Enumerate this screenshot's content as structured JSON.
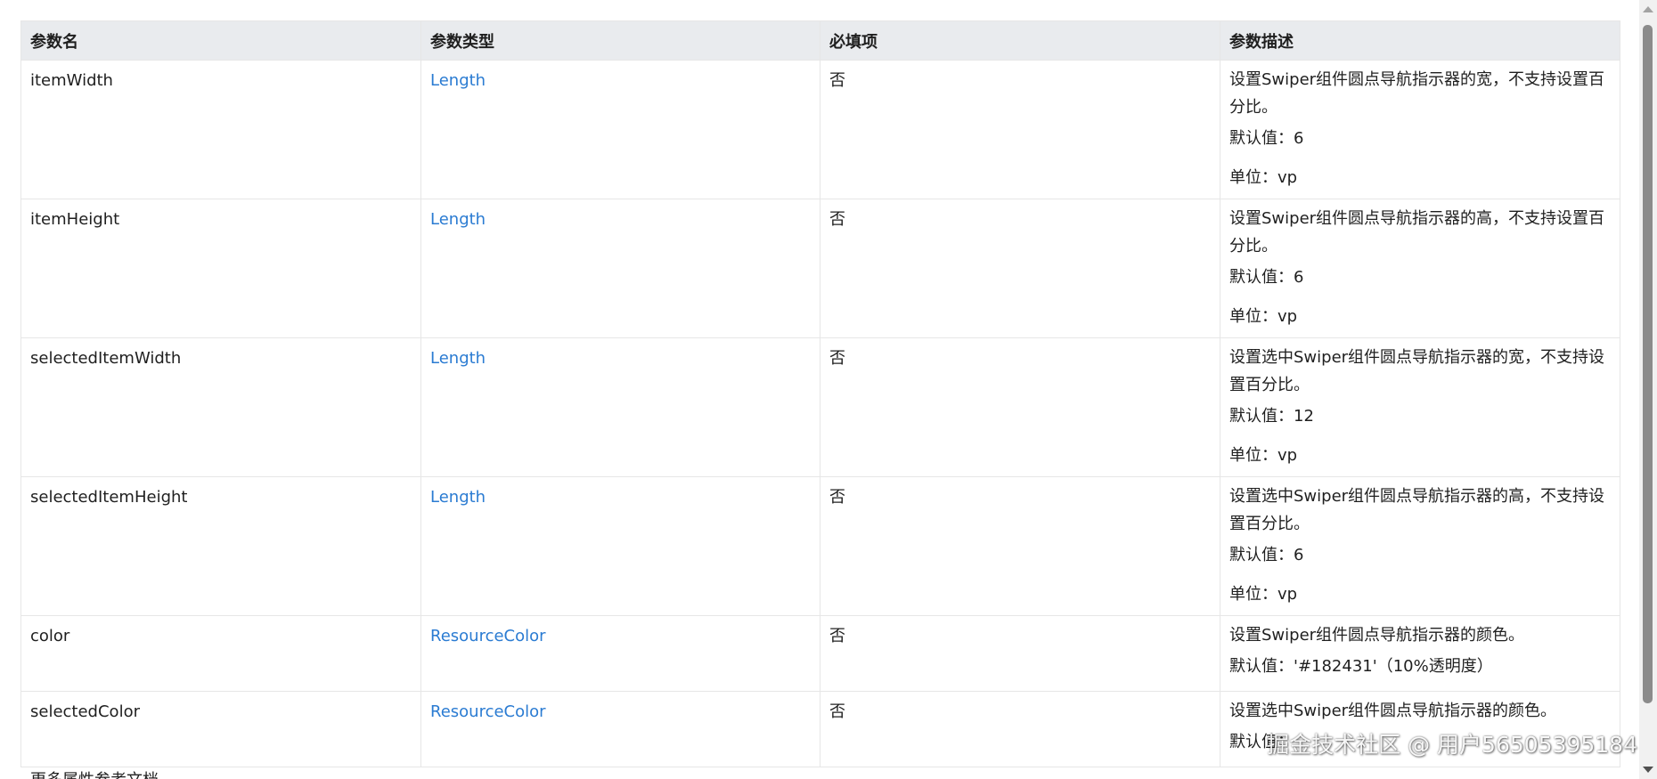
{
  "table": {
    "headers": [
      "参数名",
      "参数类型",
      "必填项",
      "参数描述"
    ],
    "rows": [
      {
        "name": "itemWidth",
        "type": "Length",
        "required": "否",
        "desc": [
          "设置Swiper组件圆点导航指示器的宽，不支持设置百分比。",
          "默认值：6",
          "单位：vp"
        ]
      },
      {
        "name": "itemHeight",
        "type": "Length",
        "required": "否",
        "desc": [
          "设置Swiper组件圆点导航指示器的高，不支持设置百分比。",
          "默认值：6",
          "单位：vp"
        ]
      },
      {
        "name": "selectedItemWidth",
        "type": "Length",
        "required": "否",
        "desc": [
          "设置选中Swiper组件圆点导航指示器的宽，不支持设置百分比。",
          "默认值：12",
          "单位：vp"
        ]
      },
      {
        "name": "selectedItemHeight",
        "type": "Length",
        "required": "否",
        "desc": [
          "设置选中Swiper组件圆点导航指示器的高，不支持设置百分比。",
          "默认值：6",
          "单位：vp"
        ]
      },
      {
        "name": "color",
        "type": "ResourceColor",
        "required": "否",
        "desc": [
          "设置Swiper组件圆点导航指示器的颜色。",
          "默认值：'#182431'（10%透明度）"
        ]
      },
      {
        "name": "selectedColor",
        "type": "ResourceColor",
        "required": "否",
        "desc": [
          "设置选中Swiper组件圆点导航指示器的颜色。",
          "默认值："
        ]
      }
    ]
  },
  "more_text": "更多属性参考文档",
  "watermark": "掘金技术社区 @ 用户56505395184",
  "colors": {
    "link": "#2a7bd2",
    "header_bg": "#e9ebee",
    "border": "#e6e6e6"
  }
}
